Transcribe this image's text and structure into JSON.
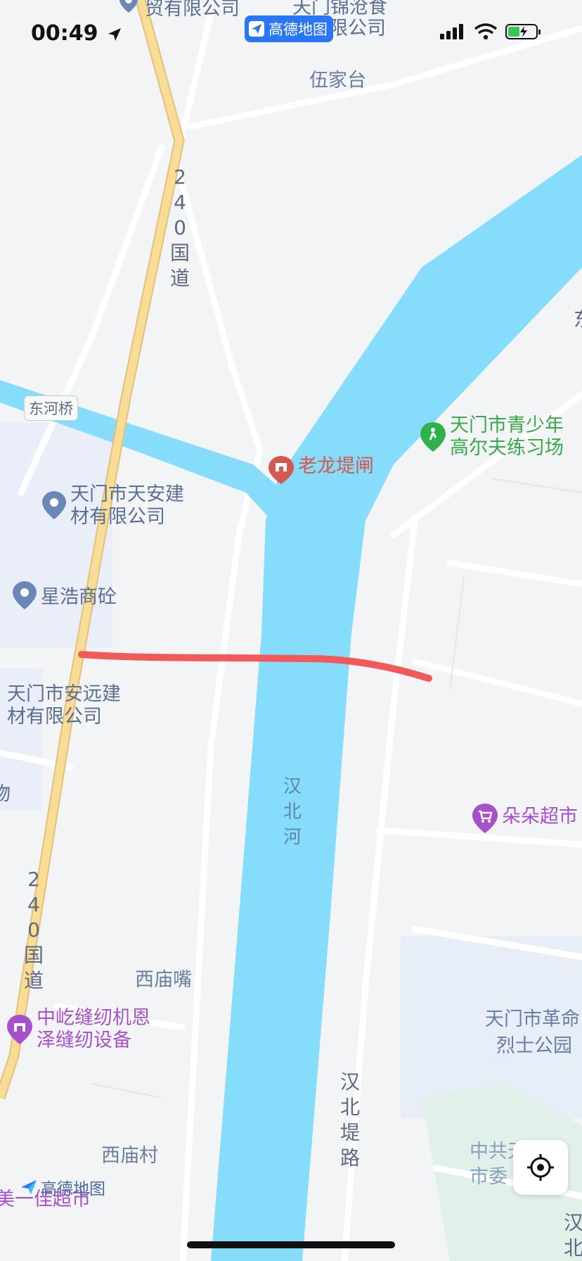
{
  "status_bar": {
    "time": "00:49"
  },
  "app_chip": {
    "label": "高德地图"
  },
  "labels": {
    "top_company_1": "贸有限公司",
    "top_company_2_line1": "天门锦沧食",
    "top_company_2_line2": "限公司",
    "wujiatai": "伍家台",
    "national_road_upper": [
      "2",
      "4",
      "0",
      "国",
      "道"
    ],
    "national_road_lower": [
      "2",
      "4",
      "0",
      "国",
      "道"
    ],
    "donghe_bridge": "东河桥",
    "laolongdi_gate": "老龙堤闸",
    "golf_line1": "天门市青少年",
    "golf_line2": "高尔夫练习场",
    "tianan_line1": "天门市天安建",
    "tianan_line2": "材有限公司",
    "xinghao": "星浩商砼",
    "anyuan_line1": "天门市安远建",
    "anyuan_line2": "材有限公司",
    "cut_char": "物",
    "hanbei_river": [
      "汉",
      "北",
      "河"
    ],
    "duoduo": "朵朵超市",
    "ximiaozui": "西庙嘴",
    "sewing_line1": "中屹缝纫机恩",
    "sewing_line2": "泽缝纫设备",
    "revolution_line1": "天门市革命",
    "revolution_line2": "烈士公园",
    "hanbei_dike_road": [
      "汉",
      "北",
      "堤",
      "路"
    ],
    "ximiao_village": "西庙村",
    "committee_line1": "中共天门",
    "committee_line2": "市委",
    "supermarket_partial": "美一佳超市",
    "watermark": "高德地图",
    "bottom_right_partial": [
      "汉",
      "北"
    ],
    "right_edge_partial": "东"
  },
  "colors": {
    "water": "#86dcfb",
    "national_road": "#f9dc95",
    "route_highlight": "#f25a5a",
    "background": "#f3f4f6"
  },
  "icons": [
    "poi-pin-icon",
    "golf-icon",
    "gate-icon",
    "shopping-cart-icon",
    "sewing-shop-icon",
    "locate-icon",
    "amap-logo-icon",
    "location-arrow-icon",
    "signal-icon",
    "wifi-icon",
    "battery-icon"
  ]
}
